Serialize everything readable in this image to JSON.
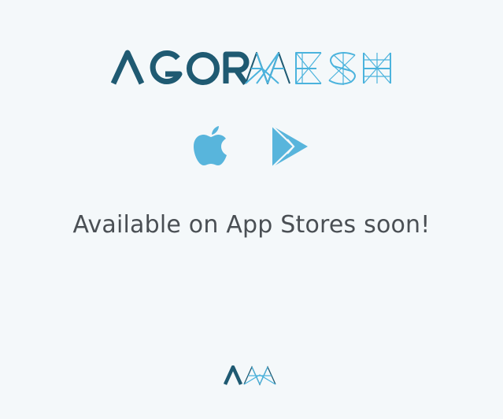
{
  "brand": {
    "name_part_1": "AGOR",
    "name_part_2": "MESH",
    "primary_color": "#1f5a72",
    "accent_color": "#4bb3dd"
  },
  "stores": [
    {
      "icon": "apple-icon",
      "color": "#58b5dc"
    },
    {
      "icon": "google-play-icon",
      "color": "#58b5dc"
    }
  ],
  "tagline": "Available on App Stores soon!",
  "footer": {
    "logo_icon": "agormesh-monogram-icon"
  }
}
